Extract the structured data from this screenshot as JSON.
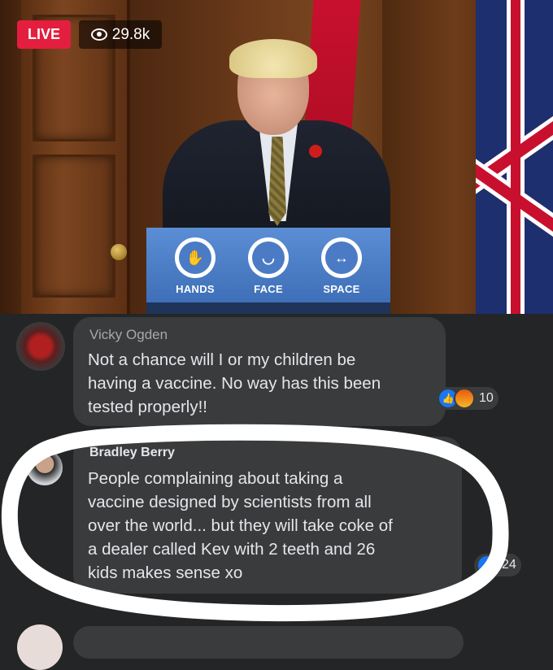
{
  "video": {
    "live_label": "LIVE",
    "viewers": "29.8k",
    "podium_signs": [
      "HANDS",
      "FACE",
      "SPACE"
    ]
  },
  "comments": [
    {
      "author": "Vicky Ogden",
      "text": "Not a chance will I or my children be\nhaving a vaccine.  No way has this been\ntested properly!!",
      "reaction_count": "10",
      "reactions": [
        "like-icon",
        "angry-icon"
      ]
    },
    {
      "author": "Bradley Berry",
      "text": "People complaining about taking a\nvaccine designed by scientists from all\nover the world... but they will take coke of\na dealer called Kev with 2 teeth and 26\nkids  makes sense xo",
      "reaction_count": "24",
      "reactions": [
        "like-icon"
      ]
    }
  ],
  "colors": {
    "live_red": "#e41e3f",
    "comment_bg": "#3a3b3c",
    "page_bg": "#242526",
    "like_blue": "#1877f2"
  }
}
